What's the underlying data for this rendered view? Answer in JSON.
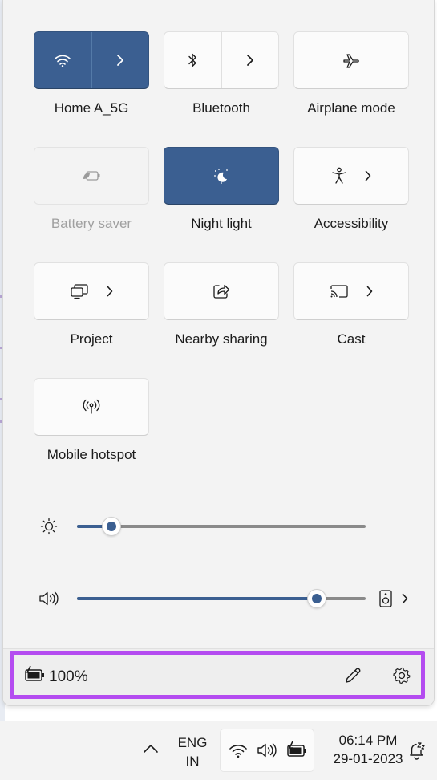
{
  "quick_settings": {
    "tiles": [
      {
        "label": "Home A_5G",
        "icon": "wifi-icon",
        "state": "on",
        "has_chevron": true
      },
      {
        "label": "Bluetooth",
        "icon": "bluetooth-icon",
        "state": "off",
        "has_chevron": true
      },
      {
        "label": "Airplane mode",
        "icon": "airplane-icon",
        "state": "off",
        "has_chevron": false
      },
      {
        "label": "Battery saver",
        "icon": "battery-saver-icon",
        "state": "disabled",
        "has_chevron": false
      },
      {
        "label": "Night light",
        "icon": "night-light-icon",
        "state": "on",
        "has_chevron": false
      },
      {
        "label": "Accessibility",
        "icon": "accessibility-icon",
        "state": "off",
        "has_chevron": true
      },
      {
        "label": "Project",
        "icon": "project-icon",
        "state": "off",
        "has_chevron": true
      },
      {
        "label": "Nearby sharing",
        "icon": "nearby-sharing-icon",
        "state": "off",
        "has_chevron": false
      },
      {
        "label": "Cast",
        "icon": "cast-icon",
        "state": "off",
        "has_chevron": true
      },
      {
        "label": "Mobile hotspot",
        "icon": "mobile-hotspot-icon",
        "state": "off",
        "has_chevron": false
      }
    ],
    "brightness": {
      "icon": "brightness-icon",
      "level": 0.12
    },
    "volume": {
      "icon": "volume-icon",
      "level": 0.83,
      "output_icon": "speaker-device-icon"
    }
  },
  "footer": {
    "battery_icon": "battery-charging-icon",
    "battery_percent": "100%",
    "edit_icon": "pencil-icon",
    "settings_icon": "gear-icon",
    "highlight_color": "#b44cf0"
  },
  "taskbar": {
    "lang_line1": "ENG",
    "lang_line2": "IN",
    "time": "06:14 PM",
    "date": "29-01-2023",
    "tray_icons": [
      "wifi-icon",
      "volume-icon",
      "battery-charging-icon"
    ],
    "notification_icon": "do-not-disturb-bell-icon"
  },
  "colors": {
    "accent": "#3b5f91",
    "panel_bg": "#f3f3f3",
    "tile_bg": "#fbfbfb"
  }
}
